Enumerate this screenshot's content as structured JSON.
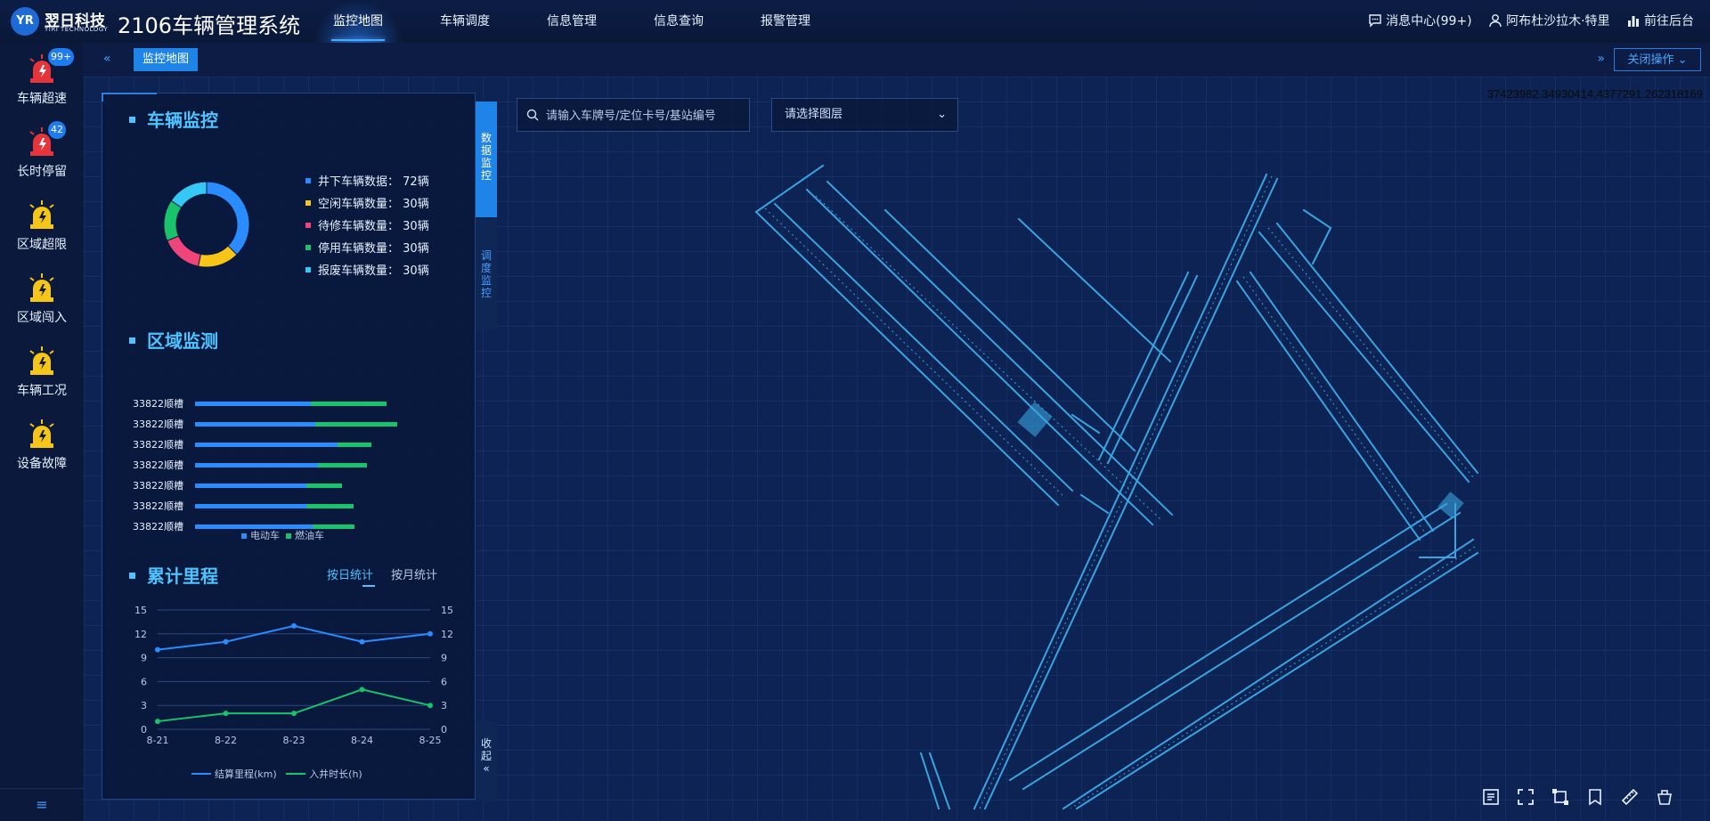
{
  "brand": {
    "badge": "YR",
    "name": "翌日科技",
    "sub": "YIRI TECHNOLOGY"
  },
  "app_title": "2106车辆管理系统",
  "nav": [
    "监控地图",
    "车辆调度",
    "信息管理",
    "信息查询",
    "报警管理"
  ],
  "nav_active": 0,
  "top_right": {
    "messages": "消息中心(99+)",
    "user": "阿布杜沙拉木·特里",
    "backend": "前往后台"
  },
  "sidebar": [
    {
      "label": "车辆超速",
      "badge": "99+",
      "color": "#e5343a"
    },
    {
      "label": "长时停留",
      "badge": "42",
      "color": "#e5343a"
    },
    {
      "label": "区域超限",
      "badge": "",
      "color": "#f5c518"
    },
    {
      "label": "区域闯入",
      "badge": "",
      "color": "#f5c518"
    },
    {
      "label": "车辆工况",
      "badge": "",
      "color": "#f5c518"
    },
    {
      "label": "设备故障",
      "badge": "",
      "color": "#f5c518"
    }
  ],
  "tabbar": {
    "active_tab": "监控地图",
    "close_ops": "关闭操作"
  },
  "map": {
    "coord": "37423982.34930414,4377291.262318169",
    "search_placeholder": "请输入车牌号/定位卡号/基站编号",
    "layer_select": "请选择图层"
  },
  "vtabs": {
    "data": "数据监控",
    "dispatch": "调度监控",
    "collapse": "收起"
  },
  "vehicle_monitor": {
    "title": "车辆监控",
    "items": [
      {
        "label": "井下车辆数据：",
        "value": "72辆",
        "num": 72,
        "color": "#2a8cff"
      },
      {
        "label": "空闲车辆数量：",
        "value": "30辆",
        "num": 30,
        "color": "#f5c518"
      },
      {
        "label": "待修车辆数量：",
        "value": "30辆",
        "num": 30,
        "color": "#f0457a"
      },
      {
        "label": "停用车辆数量：",
        "value": "30辆",
        "num": 30,
        "color": "#19c36b"
      },
      {
        "label": "报废车辆数量：",
        "value": "30辆",
        "num": 30,
        "color": "#35c8f5"
      }
    ]
  },
  "area_monitor": {
    "title": "区域监测",
    "legend": [
      "电动车",
      "燃油车"
    ],
    "rows": [
      {
        "label": "33822顺槽",
        "electric": 130,
        "fuel": 85
      },
      {
        "label": "33822顺槽",
        "electric": 135,
        "fuel": 92
      },
      {
        "label": "33822顺槽",
        "electric": 160,
        "fuel": 38
      },
      {
        "label": "33822顺槽",
        "electric": 138,
        "fuel": 55
      },
      {
        "label": "33822顺槽",
        "electric": 125,
        "fuel": 40
      },
      {
        "label": "33822顺槽",
        "electric": 125,
        "fuel": 53
      },
      {
        "label": "33822顺槽",
        "electric": 132,
        "fuel": 47
      }
    ]
  },
  "mileage": {
    "title": "累计里程",
    "tabs": [
      "按日统计",
      "按月统计"
    ],
    "active_tab": 0
  },
  "chart_data": {
    "type": "line",
    "x": [
      "8-21",
      "8-22",
      "8-23",
      "8-24",
      "8-25"
    ],
    "series": [
      {
        "name": "结算里程(km)",
        "values": [
          10,
          11,
          13,
          11,
          12
        ],
        "color": "#2a8cff"
      },
      {
        "name": "入井时长(h)",
        "values": [
          1,
          2,
          2,
          5,
          3
        ],
        "color": "#19c36b"
      }
    ],
    "ylim": [
      0,
      15
    ],
    "yticks": [
      0,
      3,
      6,
      9,
      12,
      15
    ],
    "grid": true,
    "legend": "bottom"
  }
}
